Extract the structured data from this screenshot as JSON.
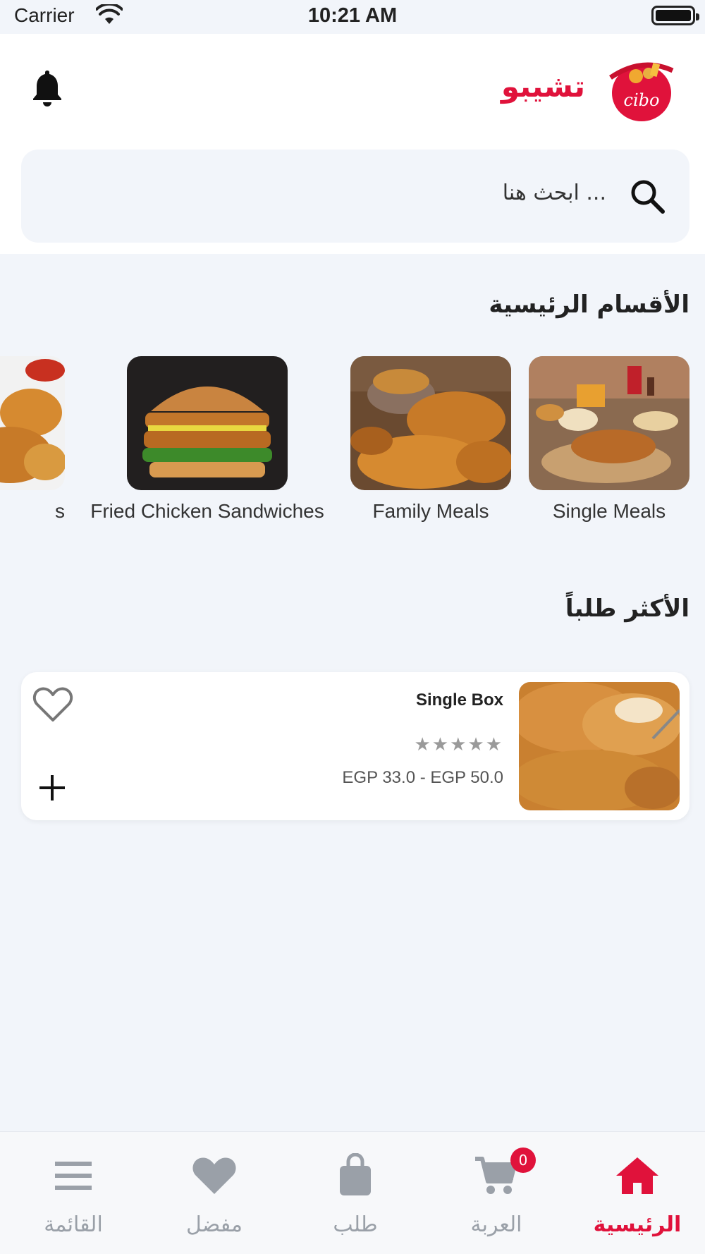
{
  "status_bar": {
    "carrier": "Carrier",
    "time": "10:21 AM"
  },
  "header": {
    "brand_name": "تشيبو",
    "logo_text": "cibo"
  },
  "search": {
    "placeholder": "ابحث هنا ..."
  },
  "categories_section": {
    "title": "الأقسام الرئيسية",
    "items": [
      {
        "label": "Single Meals"
      },
      {
        "label": "Family Meals"
      },
      {
        "label": "Fried Chicken Sandwiches"
      },
      {
        "label": "s"
      }
    ]
  },
  "popular_section": {
    "title": "الأكثر طلباً",
    "products": [
      {
        "name": "Single Box",
        "rating_stars": "★★★★★",
        "price": "EGP 33.0 - EGP 50.0"
      }
    ]
  },
  "tabbar": {
    "tabs": [
      {
        "label": "الرئيسية",
        "icon": "home-icon",
        "active": true
      },
      {
        "label": "العربة",
        "icon": "cart-icon",
        "badge": "0"
      },
      {
        "label": "طلب",
        "icon": "bag-icon"
      },
      {
        "label": "مفضل",
        "icon": "heart-icon"
      },
      {
        "label": "القائمة",
        "icon": "menu-icon"
      }
    ]
  },
  "colors": {
    "accent": "#e0123b",
    "background": "#f2f5fa",
    "inactive": "#9aa0a8"
  }
}
